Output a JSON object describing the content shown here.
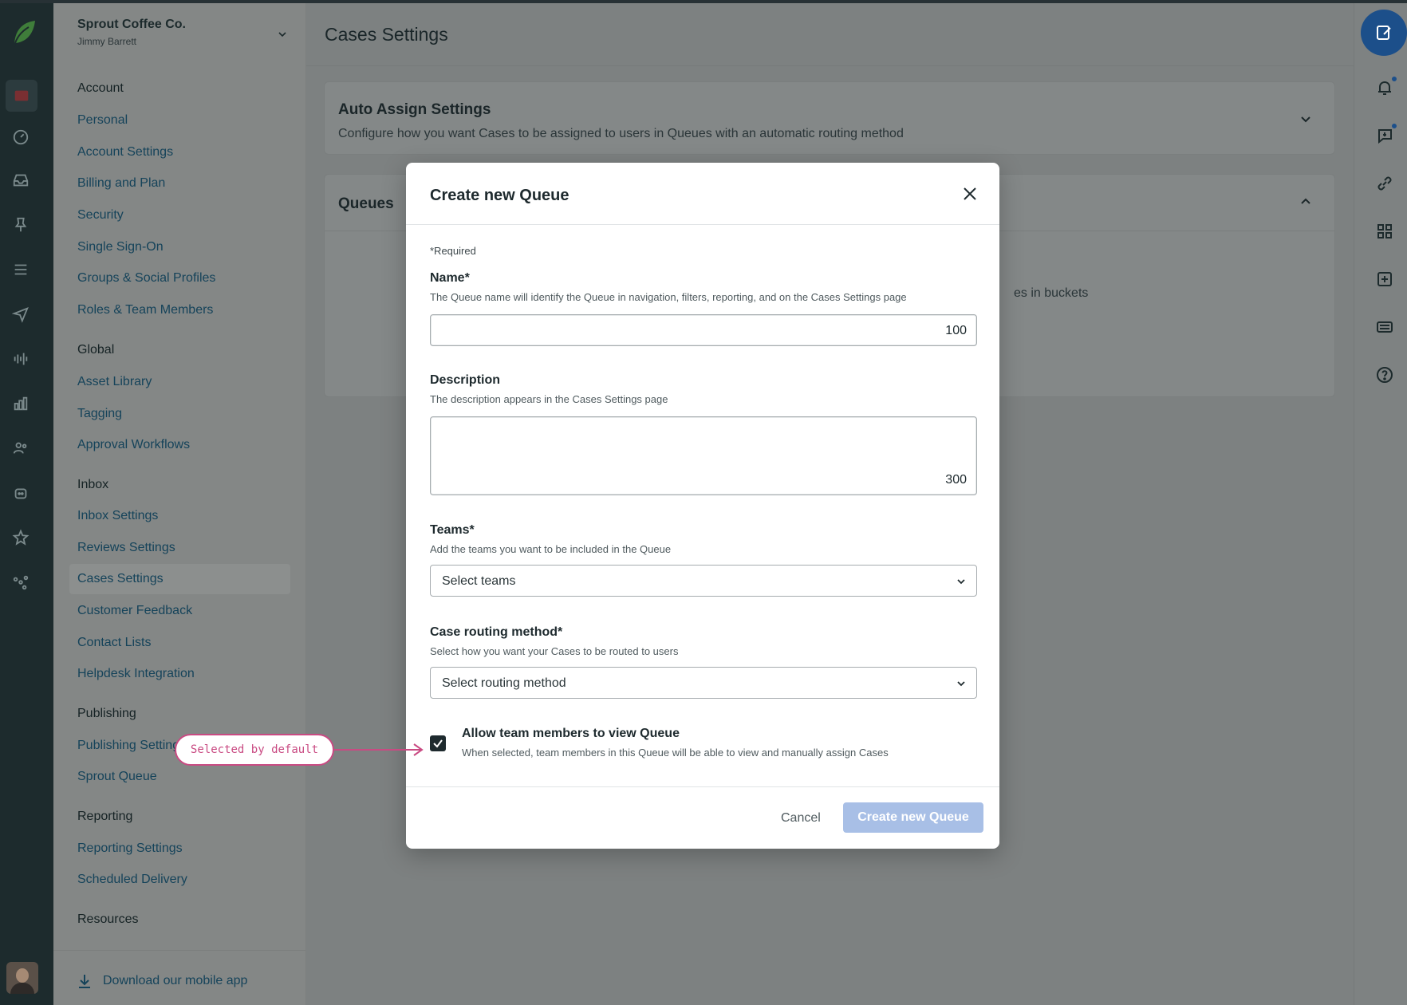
{
  "workspace": {
    "org_name": "Sprout Coffee Co.",
    "user_name": "Jimmy Barrett"
  },
  "nav": {
    "sections": [
      {
        "title": "Account",
        "items": [
          "Personal",
          "Account Settings",
          "Billing and Plan",
          "Security",
          "Single Sign-On",
          "Groups & Social Profiles",
          "Roles & Team Members"
        ]
      },
      {
        "title": "Global",
        "items": [
          "Asset Library",
          "Tagging",
          "Approval Workflows"
        ]
      },
      {
        "title": "Inbox",
        "items": [
          "Inbox Settings",
          "Reviews Settings",
          "Cases Settings",
          "Customer Feedback",
          "Contact Lists",
          "Helpdesk Integration"
        ]
      },
      {
        "title": "Publishing",
        "items": [
          "Publishing Settings",
          "Sprout Queue"
        ]
      },
      {
        "title": "Reporting",
        "items": [
          "Reporting Settings",
          "Scheduled Delivery"
        ]
      },
      {
        "title": "Resources",
        "items": []
      }
    ],
    "active_item": "Cases Settings",
    "download_label": "Download our mobile app"
  },
  "page": {
    "title": "Cases Settings",
    "auto_assign": {
      "title": "Auto Assign Settings",
      "description": "Configure how you want Cases to be assigned to users in Queues with an automatic routing method"
    },
    "queues": {
      "title": "Queues",
      "hint": "es in buckets"
    }
  },
  "modal": {
    "title": "Create new Queue",
    "required_note": "*Required",
    "name": {
      "label": "Name*",
      "help": "The Queue name will identify the Queue in navigation, filters, reporting, and on the Cases Settings page",
      "value": "",
      "max": "100"
    },
    "description": {
      "label": "Description",
      "help": "The description appears in the Cases Settings page",
      "value": "",
      "max": "300"
    },
    "teams": {
      "label": "Teams*",
      "help": "Add the teams you want to be included in the Queue",
      "placeholder": "Select teams"
    },
    "routing": {
      "label": "Case routing method*",
      "help": "Select how you want your Cases to be routed to users",
      "placeholder": "Select routing method"
    },
    "allow_view": {
      "label": "Allow team members to view Queue",
      "help": "When selected, team members in this Queue will be able to view and manually assign Cases",
      "checked": true
    },
    "cancel_label": "Cancel",
    "create_label": "Create new Queue"
  },
  "annotation": {
    "text": "Selected by default"
  },
  "colors": {
    "accent": "#1c4f8a",
    "disabled_primary": "#a8bfe6",
    "annotation": "#c94a82"
  }
}
